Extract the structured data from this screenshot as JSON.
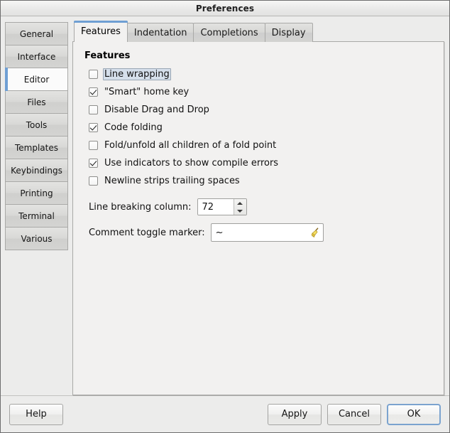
{
  "window": {
    "title": "Preferences"
  },
  "sidebar": {
    "items": [
      {
        "label": "General",
        "selected": false
      },
      {
        "label": "Interface",
        "selected": false
      },
      {
        "label": "Editor",
        "selected": true
      },
      {
        "label": "Files",
        "selected": false
      },
      {
        "label": "Tools",
        "selected": false
      },
      {
        "label": "Templates",
        "selected": false
      },
      {
        "label": "Keybindings",
        "selected": false
      },
      {
        "label": "Printing",
        "selected": false
      },
      {
        "label": "Terminal",
        "selected": false
      },
      {
        "label": "Various",
        "selected": false
      }
    ]
  },
  "tabs": [
    {
      "label": "Features",
      "active": true
    },
    {
      "label": "Indentation",
      "active": false
    },
    {
      "label": "Completions",
      "active": false
    },
    {
      "label": "Display",
      "active": false
    }
  ],
  "panel": {
    "heading": "Features",
    "checkboxes": [
      {
        "label": "Line wrapping",
        "checked": false,
        "focused": true
      },
      {
        "label": "\"Smart\" home key",
        "checked": true,
        "focused": false
      },
      {
        "label": "Disable Drag and Drop",
        "checked": false,
        "focused": false
      },
      {
        "label": "Code folding",
        "checked": true,
        "focused": false
      },
      {
        "label": "Fold/unfold all children of a fold point",
        "checked": false,
        "focused": false
      },
      {
        "label": "Use indicators to show compile errors",
        "checked": true,
        "focused": false
      },
      {
        "label": "Newline strips trailing spaces",
        "checked": false,
        "focused": false
      }
    ],
    "line_breaking": {
      "label": "Line breaking column:",
      "value": "72"
    },
    "comment_marker": {
      "label": "Comment toggle marker:",
      "value": "~",
      "icon": "broom-icon"
    }
  },
  "footer": {
    "help": "Help",
    "apply": "Apply",
    "cancel": "Cancel",
    "ok": "OK"
  },
  "colors": {
    "accent": "#6f9fd3",
    "focus_border": "#7ba3cf",
    "window_bg": "#ececeb",
    "panel_bg": "#f2f1f0",
    "selected_bg": "#fbfbfb",
    "focus_fill": "#d5dfeb"
  }
}
